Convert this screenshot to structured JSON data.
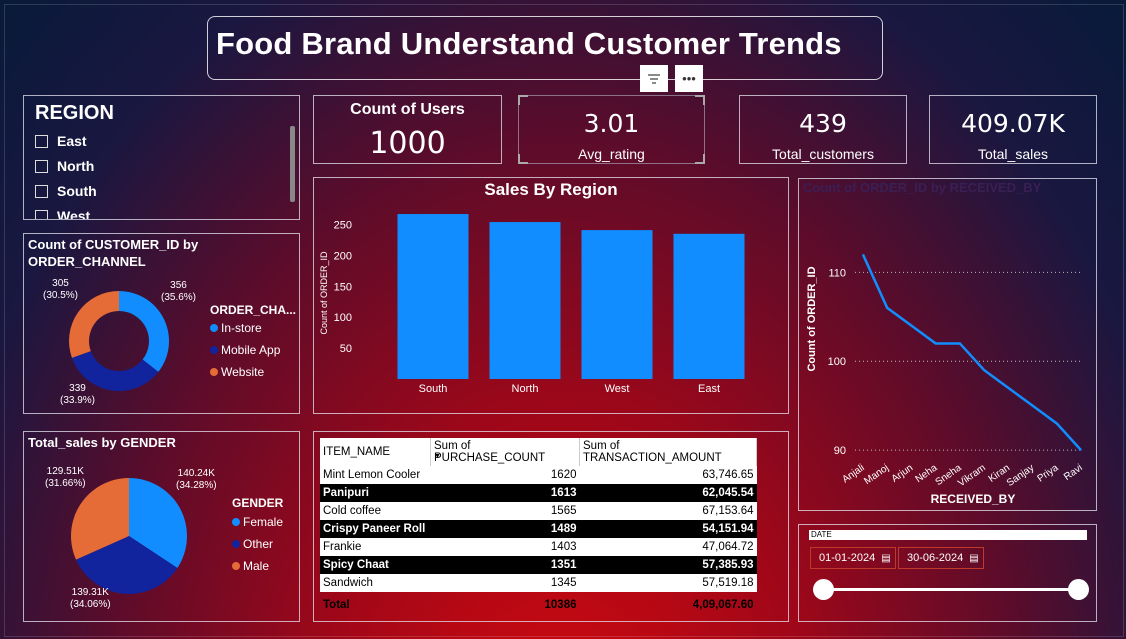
{
  "title": "Food Brand Understand Customer Trends",
  "header_icons": [
    "filter-icon",
    "more-options-icon"
  ],
  "region_slicer": {
    "header": "REGION",
    "items": [
      "East",
      "North",
      "South",
      "West"
    ]
  },
  "kpis": {
    "users_label": "Count of Users",
    "users_value": "1000",
    "rating_value": "3.01",
    "rating_label": "Avg_rating",
    "customers_value": "439",
    "customers_label": "Total_customers",
    "sales_value": "409.07K",
    "sales_label": "Total_sales"
  },
  "channel_chart": {
    "title_line1": "Count of CUSTOMER_ID by",
    "title_line2": "ORDER_CHANNEL",
    "legend_title": "ORDER_CHA...",
    "legend": [
      "In-store",
      "Mobile App",
      "Website"
    ],
    "labels": {
      "instore_v": "356",
      "instore_p": "(35.6%)",
      "mobile_v": "339",
      "mobile_p": "(33.9%)",
      "web_v": "305",
      "web_p": "(30.5%)"
    },
    "colors": {
      "In-store": "#118dff",
      "Mobile App": "#12239e",
      "Website": "#e66c37"
    }
  },
  "gender_chart": {
    "title": "Total_sales by GENDER",
    "legend_title": "GENDER",
    "legend": [
      "Female",
      "Other",
      "Male"
    ],
    "labels": {
      "female_v": "140.24K",
      "female_p": "(34.28%)",
      "other_v": "139.31K",
      "other_p": "(34.06%)",
      "male_v": "129.51K",
      "male_p": "(31.66%)"
    }
  },
  "chart_data": [
    {
      "type": "bar",
      "title": "Sales By Region",
      "xlabel": "",
      "ylabel": "Count of ORDER_ID",
      "categories": [
        "South",
        "North",
        "West",
        "East"
      ],
      "values": [
        267,
        254,
        241,
        235
      ],
      "yticks": [
        50,
        100,
        150,
        200,
        250
      ],
      "ylim": [
        0,
        280
      ],
      "color": "#118dff"
    },
    {
      "type": "line",
      "title": "Count of ORDER_ID by RECEIVED_BY",
      "xlabel": "RECEIVED_BY",
      "ylabel": "Count of ORDER_ID",
      "categories": [
        "Anjali",
        "Manoj",
        "Arjun",
        "Neha",
        "Sneha",
        "Vikram",
        "Kiran",
        "Sanjay",
        "Priya",
        "Ravi"
      ],
      "values": [
        112,
        106,
        104,
        102,
        102,
        99,
        97,
        95,
        93,
        90
      ],
      "yticks": [
        90,
        100,
        110
      ],
      "ylim": [
        89,
        116
      ],
      "color": "#118dff"
    },
    {
      "type": "pie",
      "title": "Count of CUSTOMER_ID by ORDER_CHANNEL",
      "categories": [
        "In-store",
        "Mobile App",
        "Website"
      ],
      "values": [
        356,
        339,
        305
      ]
    },
    {
      "type": "pie",
      "title": "Total_sales by GENDER",
      "categories": [
        "Female",
        "Other",
        "Male"
      ],
      "values": [
        140.24,
        139.31,
        129.51
      ]
    }
  ],
  "table": {
    "headers": [
      "ITEM_NAME",
      "Sum of PURCHASE_COUNT",
      "Sum of TRANSACTION_AMOUNT"
    ],
    "rows": [
      [
        "Mint Lemon Cooler",
        "1620",
        "63,746.65"
      ],
      [
        "Panipuri",
        "1613",
        "62,045.54"
      ],
      [
        "Cold coffee",
        "1565",
        "67,153.64"
      ],
      [
        "Crispy Paneer Roll",
        "1489",
        "54,151.94"
      ],
      [
        "Frankie",
        "1403",
        "47,064.72"
      ],
      [
        "Spicy Chaat",
        "1351",
        "57,385.93"
      ],
      [
        "Sandwich",
        "1345",
        "57,519.18"
      ]
    ],
    "total": [
      "Total",
      "10386",
      "4,09,067.60"
    ]
  },
  "date_slicer": {
    "label": "DATE",
    "start": "01-01-2024",
    "end": "30-06-2024"
  }
}
